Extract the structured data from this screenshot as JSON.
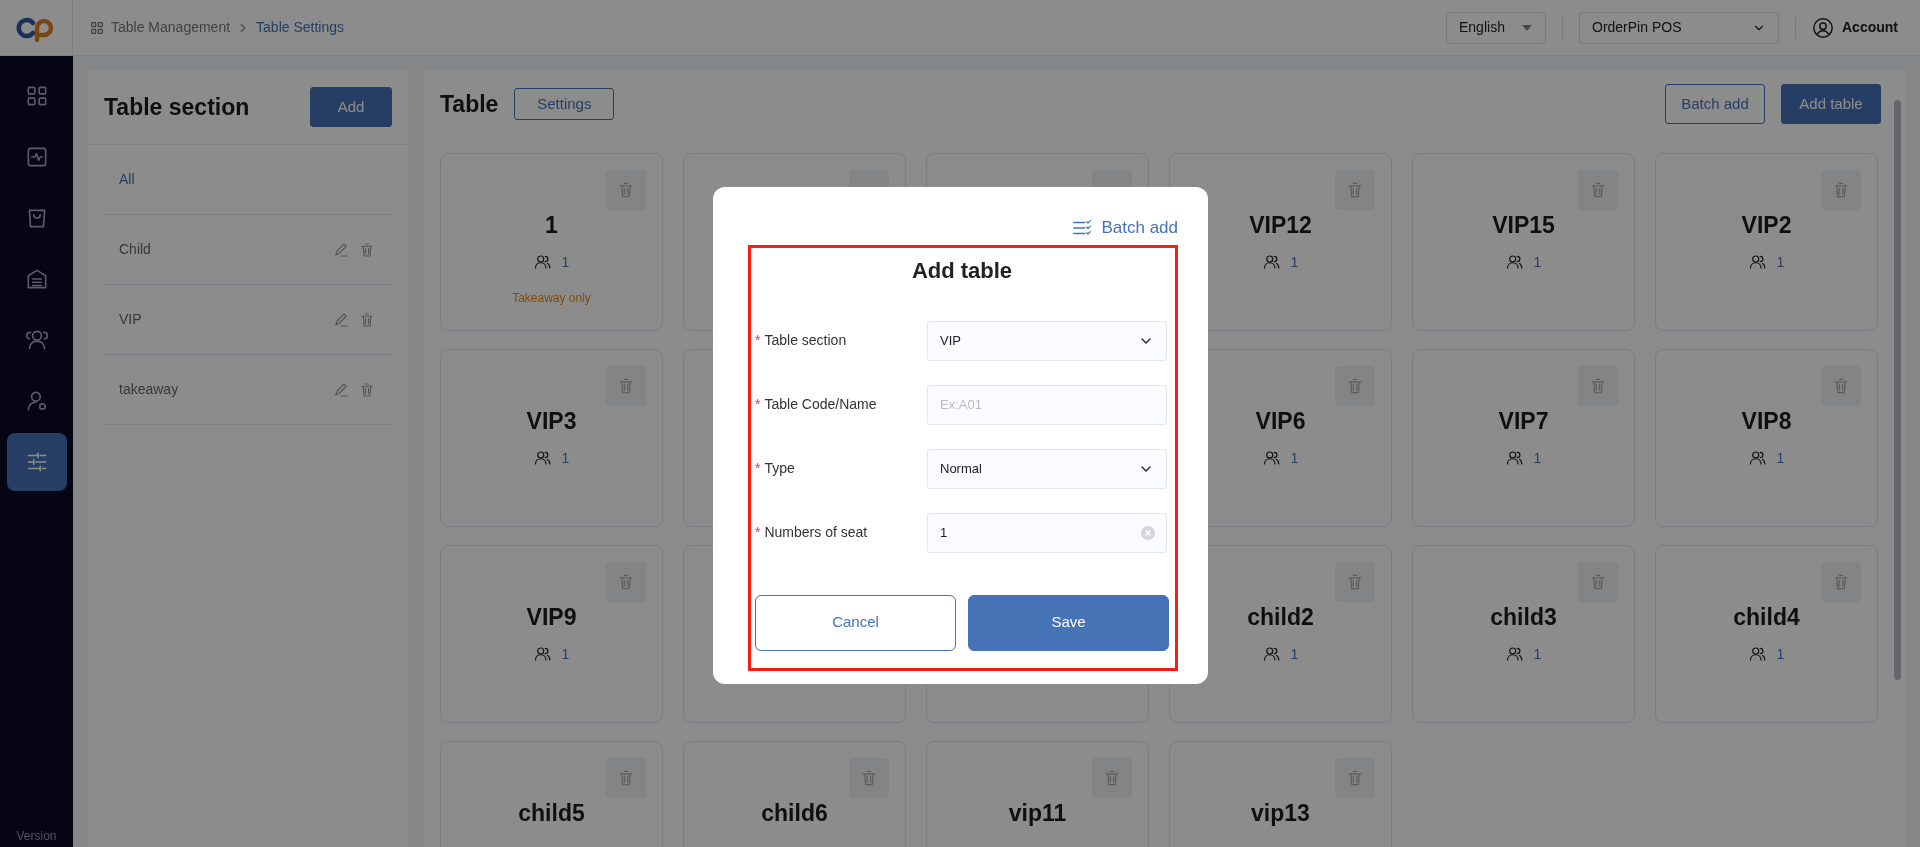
{
  "header": {
    "breadcrumb": [
      {
        "label": "Table Management",
        "current": false
      },
      {
        "label": "Table Settings",
        "current": true
      }
    ],
    "language": "English",
    "store": "OrderPin POS",
    "account": "Account"
  },
  "nav": [
    {
      "kind": "grid",
      "selected": false
    },
    {
      "kind": "pulse",
      "selected": false
    },
    {
      "kind": "bag",
      "selected": false
    },
    {
      "kind": "warehouse",
      "selected": false
    },
    {
      "kind": "users",
      "selected": false
    },
    {
      "kind": "user-gear",
      "selected": false
    },
    {
      "kind": "sliders",
      "selected": true
    }
  ],
  "version": "Version",
  "sections_panel": {
    "title": "Table section",
    "add_button": "Add",
    "items": [
      {
        "label": "All",
        "selected": true,
        "editable": false
      },
      {
        "label": "Child",
        "selected": false,
        "editable": true
      },
      {
        "label": "VIP",
        "selected": false,
        "editable": true
      },
      {
        "label": "takeaway",
        "selected": false,
        "editable": true
      }
    ]
  },
  "tables_panel": {
    "title": "Table",
    "settings_button": "Settings",
    "batch_add_button": "Batch add",
    "add_button": "Add table",
    "tables": [
      {
        "kind": "table",
        "name": "1",
        "seats": "1",
        "note": "Takeaway only"
      },
      {
        "kind": "covered"
      },
      {
        "kind": "covered"
      },
      {
        "kind": "table",
        "name": "VIP12",
        "seats": "1"
      },
      {
        "kind": "table",
        "name": "VIP15",
        "seats": "1"
      },
      {
        "kind": "table",
        "name": "VIP2",
        "seats": "1"
      },
      {
        "kind": "table",
        "name": "VIP3",
        "seats": "1"
      },
      {
        "kind": "edge"
      },
      {
        "kind": "slot"
      },
      {
        "kind": "table",
        "name": "VIP6",
        "seats": "1"
      },
      {
        "kind": "table",
        "name": "VIP7",
        "seats": "1"
      },
      {
        "kind": "table",
        "name": "VIP8",
        "seats": "1"
      },
      {
        "kind": "table",
        "name": "VIP9",
        "seats": "1"
      },
      {
        "kind": "edge"
      },
      {
        "kind": "edge"
      },
      {
        "kind": "table",
        "name": "child2",
        "seats": "1"
      },
      {
        "kind": "table",
        "name": "child3",
        "seats": "1"
      },
      {
        "kind": "table",
        "name": "child4",
        "seats": "1"
      },
      {
        "kind": "table",
        "name": "child5"
      },
      {
        "kind": "table",
        "name": "child6"
      },
      {
        "kind": "table",
        "name": "vip11"
      },
      {
        "kind": "table",
        "name": "vip13"
      }
    ]
  },
  "modal": {
    "title": "Add table",
    "batch_add": "Batch add",
    "fields": [
      {
        "kind": "select",
        "label": "Table section",
        "required_mark": "*",
        "value": "VIP"
      },
      {
        "kind": "text",
        "label": "Table Code/Name",
        "required_mark": "*",
        "placeholder": "Ex:A01"
      },
      {
        "kind": "select",
        "label": "Type",
        "required_mark": "*",
        "value": "Normal"
      },
      {
        "kind": "clearable",
        "label": "Numbers of seat",
        "required_mark": "*",
        "value": "1"
      }
    ],
    "cancel": "Cancel",
    "save": "Save"
  }
}
